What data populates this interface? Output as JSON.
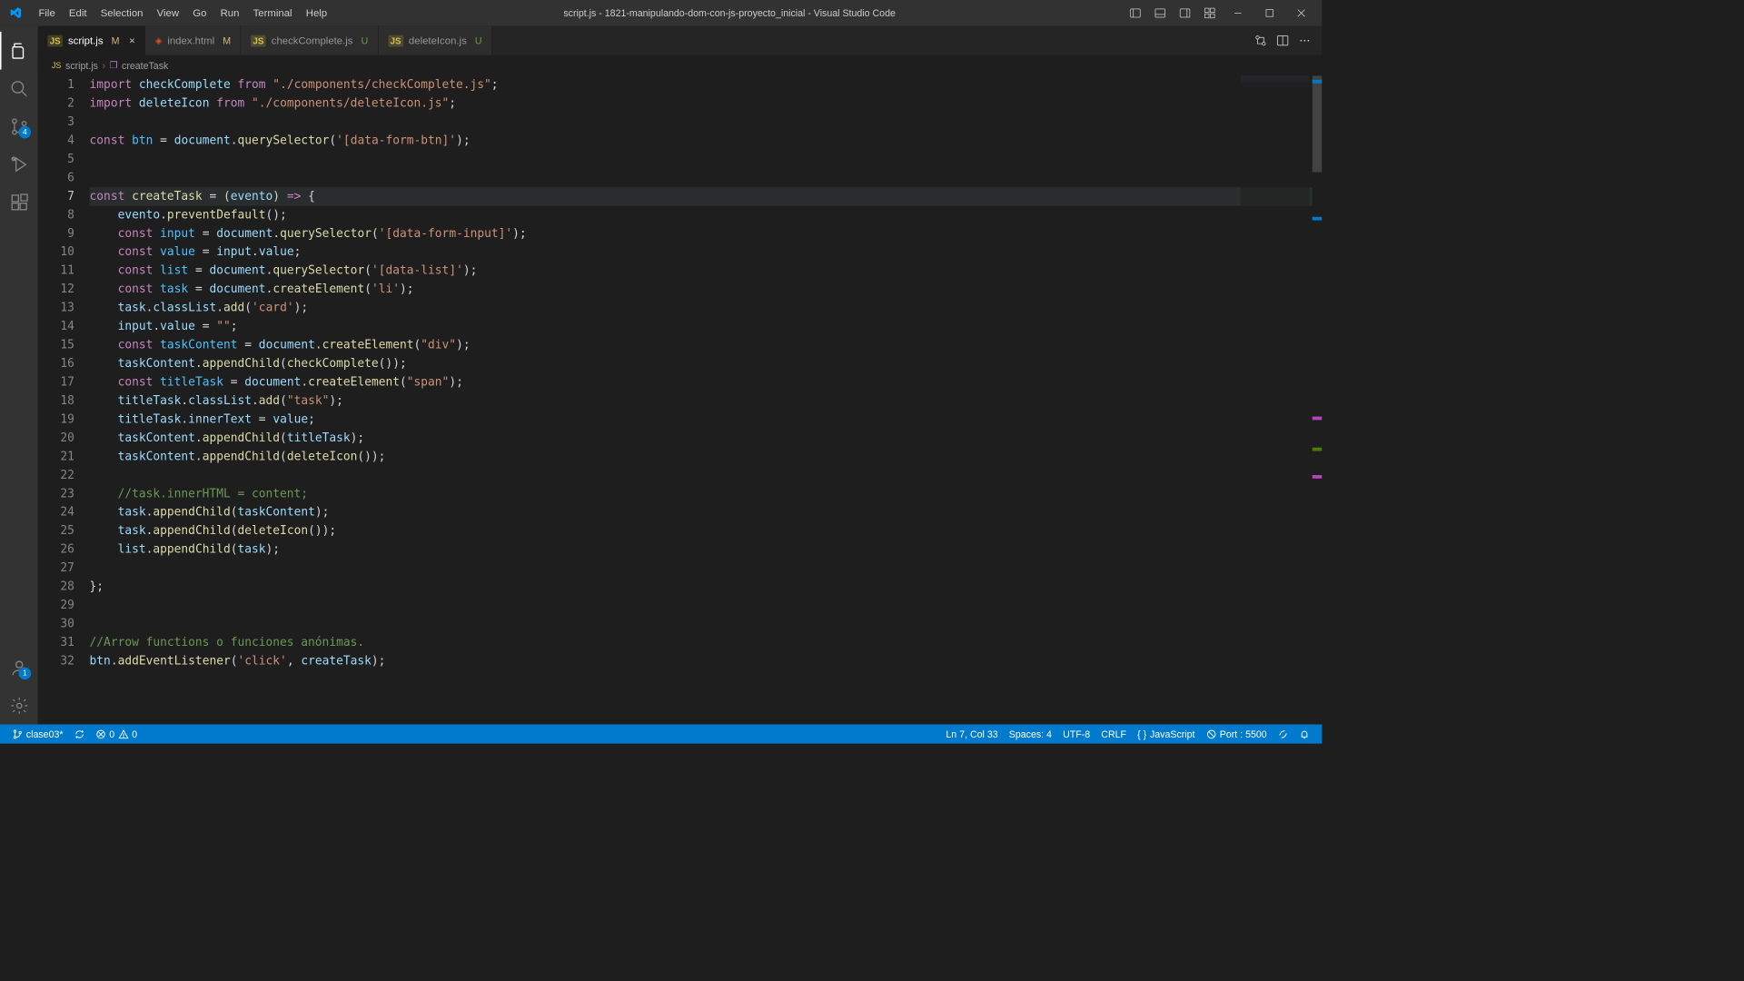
{
  "titlebar": {
    "menu": [
      "File",
      "Edit",
      "Selection",
      "View",
      "Go",
      "Run",
      "Terminal",
      "Help"
    ],
    "title": "script.js - 1821-manipulando-dom-con-js-proyecto_inicial - Visual Studio Code"
  },
  "activitybar": {
    "scm_badge": "4",
    "account_badge": "1"
  },
  "tabs": [
    {
      "name": "script.js",
      "mark": "M",
      "active": true,
      "icon": "js",
      "closable": true
    },
    {
      "name": "index.html",
      "mark": "M",
      "active": false,
      "icon": "html",
      "closable": false
    },
    {
      "name": "checkComplete.js",
      "mark": "U",
      "active": false,
      "icon": "js",
      "closable": false
    },
    {
      "name": "deleteIcon.js",
      "mark": "U",
      "active": false,
      "icon": "js",
      "closable": false
    }
  ],
  "breadcrumb": {
    "file": "script.js",
    "symbol": "createTask"
  },
  "code": {
    "current_line": 7,
    "lines": [
      {
        "n": 1,
        "html": "<span class='kw'>import</span> <span class='var'>checkComplete</span> <span class='kw'>from</span> <span class='str'>\"./components/checkComplete.js\"</span><span class='punct'>;</span>"
      },
      {
        "n": 2,
        "html": "<span class='kw'>import</span> <span class='var'>deleteIcon</span> <span class='kw'>from</span> <span class='str'>\"./components/deleteIcon.js\"</span><span class='punct'>;</span>"
      },
      {
        "n": 3,
        "html": ""
      },
      {
        "n": 4,
        "html": "<span class='kw'>const</span> <span class='const-name'>btn</span> <span class='punct'>=</span> <span class='var'>document</span><span class='punct'>.</span><span class='fn'>querySelector</span><span class='punct'>(</span><span class='str'>'[data-form-btn]'</span><span class='punct'>);</span>"
      },
      {
        "n": 5,
        "html": ""
      },
      {
        "n": 6,
        "html": ""
      },
      {
        "n": 7,
        "html": "<span class='kw'>const</span> <span class='fn'>createTask</span> <span class='punct'>= (</span><span class='var'>evento</span><span class='punct'>) </span><span class='kw'>=&gt;</span><span class='punct'> {</span>"
      },
      {
        "n": 8,
        "html": "    <span class='var'>evento</span><span class='punct'>.</span><span class='fn'>preventDefault</span><span class='punct'>();</span>"
      },
      {
        "n": 9,
        "html": "    <span class='kw'>const</span> <span class='const-name'>input</span> <span class='punct'>=</span> <span class='var'>document</span><span class='punct'>.</span><span class='fn'>querySelector</span><span class='punct'>(</span><span class='str'>'[data-form-input]'</span><span class='punct'>);</span>"
      },
      {
        "n": 10,
        "html": "    <span class='kw'>const</span> <span class='const-name'>value</span> <span class='punct'>=</span> <span class='var'>input</span><span class='punct'>.</span><span class='prop'>value</span><span class='punct'>;</span>"
      },
      {
        "n": 11,
        "html": "    <span class='kw'>const</span> <span class='const-name'>list</span> <span class='punct'>=</span> <span class='var'>document</span><span class='punct'>.</span><span class='fn'>querySelector</span><span class='punct'>(</span><span class='str'>'[data-list]'</span><span class='punct'>);</span>"
      },
      {
        "n": 12,
        "html": "    <span class='kw'>const</span> <span class='const-name'>task</span> <span class='punct'>=</span> <span class='var'>document</span><span class='punct'>.</span><span class='fn'>createElement</span><span class='punct'>(</span><span class='str'>'li'</span><span class='punct'>);</span>"
      },
      {
        "n": 13,
        "html": "    <span class='var'>task</span><span class='punct'>.</span><span class='prop'>classList</span><span class='punct'>.</span><span class='fn'>add</span><span class='punct'>(</span><span class='str'>'card'</span><span class='punct'>);</span>"
      },
      {
        "n": 14,
        "html": "    <span class='var'>input</span><span class='punct'>.</span><span class='prop'>value</span> <span class='punct'>=</span> <span class='str'>\"\"</span><span class='punct'>;</span>"
      },
      {
        "n": 15,
        "html": "    <span class='kw'>const</span> <span class='const-name'>taskContent</span> <span class='punct'>=</span> <span class='var'>document</span><span class='punct'>.</span><span class='fn'>createElement</span><span class='punct'>(</span><span class='str'>\"div\"</span><span class='punct'>);</span>"
      },
      {
        "n": 16,
        "html": "    <span class='var'>taskContent</span><span class='punct'>.</span><span class='fn'>appendChild</span><span class='punct'>(</span><span class='fn'>checkComplete</span><span class='punct'>());</span>"
      },
      {
        "n": 17,
        "html": "    <span class='kw'>const</span> <span class='const-name'>titleTask</span> <span class='punct'>=</span> <span class='var'>document</span><span class='punct'>.</span><span class='fn'>createElement</span><span class='punct'>(</span><span class='str'>\"span\"</span><span class='punct'>);</span>"
      },
      {
        "n": 18,
        "html": "    <span class='var'>titleTask</span><span class='punct'>.</span><span class='prop'>classList</span><span class='punct'>.</span><span class='fn'>add</span><span class='punct'>(</span><span class='str'>\"task\"</span><span class='punct'>);</span>"
      },
      {
        "n": 19,
        "html": "    <span class='var'>titleTask</span><span class='punct'>.</span><span class='prop'>innerText</span> <span class='punct'>=</span> <span class='var'>value</span><span class='punct'>;</span>"
      },
      {
        "n": 20,
        "html": "    <span class='var'>taskContent</span><span class='punct'>.</span><span class='fn'>appendChild</span><span class='punct'>(</span><span class='var'>titleTask</span><span class='punct'>);</span>"
      },
      {
        "n": 21,
        "html": "    <span class='var'>taskContent</span><span class='punct'>.</span><span class='fn'>appendChild</span><span class='punct'>(</span><span class='fn'>deleteIcon</span><span class='punct'>());</span>"
      },
      {
        "n": 22,
        "html": ""
      },
      {
        "n": 23,
        "html": "    <span class='cmt'>//task.innerHTML = content;</span>"
      },
      {
        "n": 24,
        "html": "    <span class='var'>task</span><span class='punct'>.</span><span class='fn'>appendChild</span><span class='punct'>(</span><span class='var'>taskContent</span><span class='punct'>);</span>"
      },
      {
        "n": 25,
        "html": "    <span class='var'>task</span><span class='punct'>.</span><span class='fn'>appendChild</span><span class='punct'>(</span><span class='fn'>deleteIcon</span><span class='punct'>());</span>"
      },
      {
        "n": 26,
        "html": "    <span class='var'>list</span><span class='punct'>.</span><span class='fn'>appendChild</span><span class='punct'>(</span><span class='var'>task</span><span class='punct'>);</span>"
      },
      {
        "n": 27,
        "html": ""
      },
      {
        "n": 28,
        "html": "<span class='punct'>};</span>"
      },
      {
        "n": 29,
        "html": ""
      },
      {
        "n": 30,
        "html": ""
      },
      {
        "n": 31,
        "html": "<span class='cmt'>//Arrow functions o funciones anónimas.</span>"
      },
      {
        "n": 32,
        "html": "<span class='var'>btn</span><span class='punct'>.</span><span class='fn'>addEventListener</span><span class='punct'>(</span><span class='str'>'click'</span><span class='punct'>, </span><span class='var'>createTask</span><span class='punct'>);</span>"
      }
    ]
  },
  "statusbar": {
    "branch": "clase03*",
    "errors": "0",
    "warnings": "0",
    "cursor": "Ln 7, Col 33",
    "spaces": "Spaces: 4",
    "encoding": "UTF-8",
    "eol": "CRLF",
    "language": "JavaScript",
    "port": "Port : 5500"
  }
}
